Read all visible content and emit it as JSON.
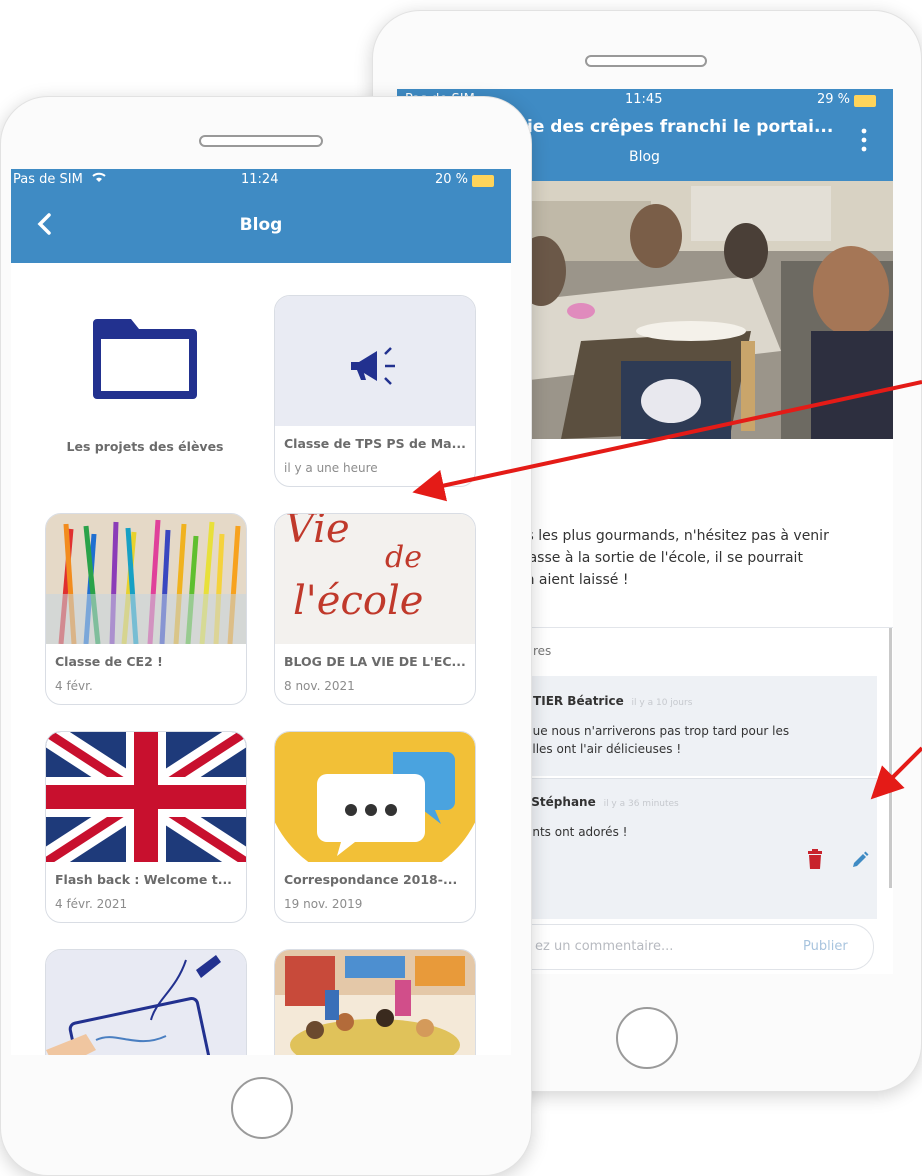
{
  "back_phone": {
    "status": {
      "carrier": "Pas de SIM",
      "time": "11:24",
      "battery": "20 %"
    },
    "header": {
      "title": "Blog"
    },
    "folder": {
      "label": "Les projets des élèves"
    },
    "cards": [
      {
        "title": "Classe de TPS PS de Ma...",
        "date": "il y a une heure"
      },
      {
        "title": "Classe de CE2 !",
        "date": "4 févr."
      },
      {
        "title": "BLOG DE LA VIE DE L'EC...",
        "date": "8 nov. 2021"
      },
      {
        "title": "Flash back : Welcome t...",
        "date": "4 févr. 2021"
      },
      {
        "title": "Correspondance 2018-...",
        "date": "19 nov. 2019"
      }
    ],
    "vie_thumb_text": {
      "line1": "Vie",
      "line2": "de",
      "line3": "l'école"
    }
  },
  "front_phone": {
    "status": {
      "carrier": "Pas de SIM",
      "time": "11:45",
      "battery": "29 %"
    },
    "header": {
      "title": "ie des crêpes franchi le portai...",
      "subtitle": "Blog"
    },
    "post_text": {
      "excl": "!",
      "line1": "ts les plus gourmands, n'hésitez pas à venir",
      "line2": "classe à la sortie de l'école, il se pourrait",
      "line3": "en aient laissé !"
    },
    "comments_header": "res",
    "comments": [
      {
        "author": "NTIER Béatrice",
        "time": "il y a 10 jours",
        "line1": "que nous n'arriverons pas trop tard pour les",
        "line2": "elles ont l'air délicieuses !"
      },
      {
        "author": "l Stéphane",
        "time": "il y a 36 minutes",
        "line1": "ants ont adorés !"
      }
    ],
    "input": {
      "placeholder": "ez un commentaire...",
      "publish": "Publier"
    }
  },
  "colors": {
    "appbar": "#3f8bc4",
    "arrow": "#e41b17",
    "folder": "#22318f",
    "delete": "#c8232c"
  }
}
